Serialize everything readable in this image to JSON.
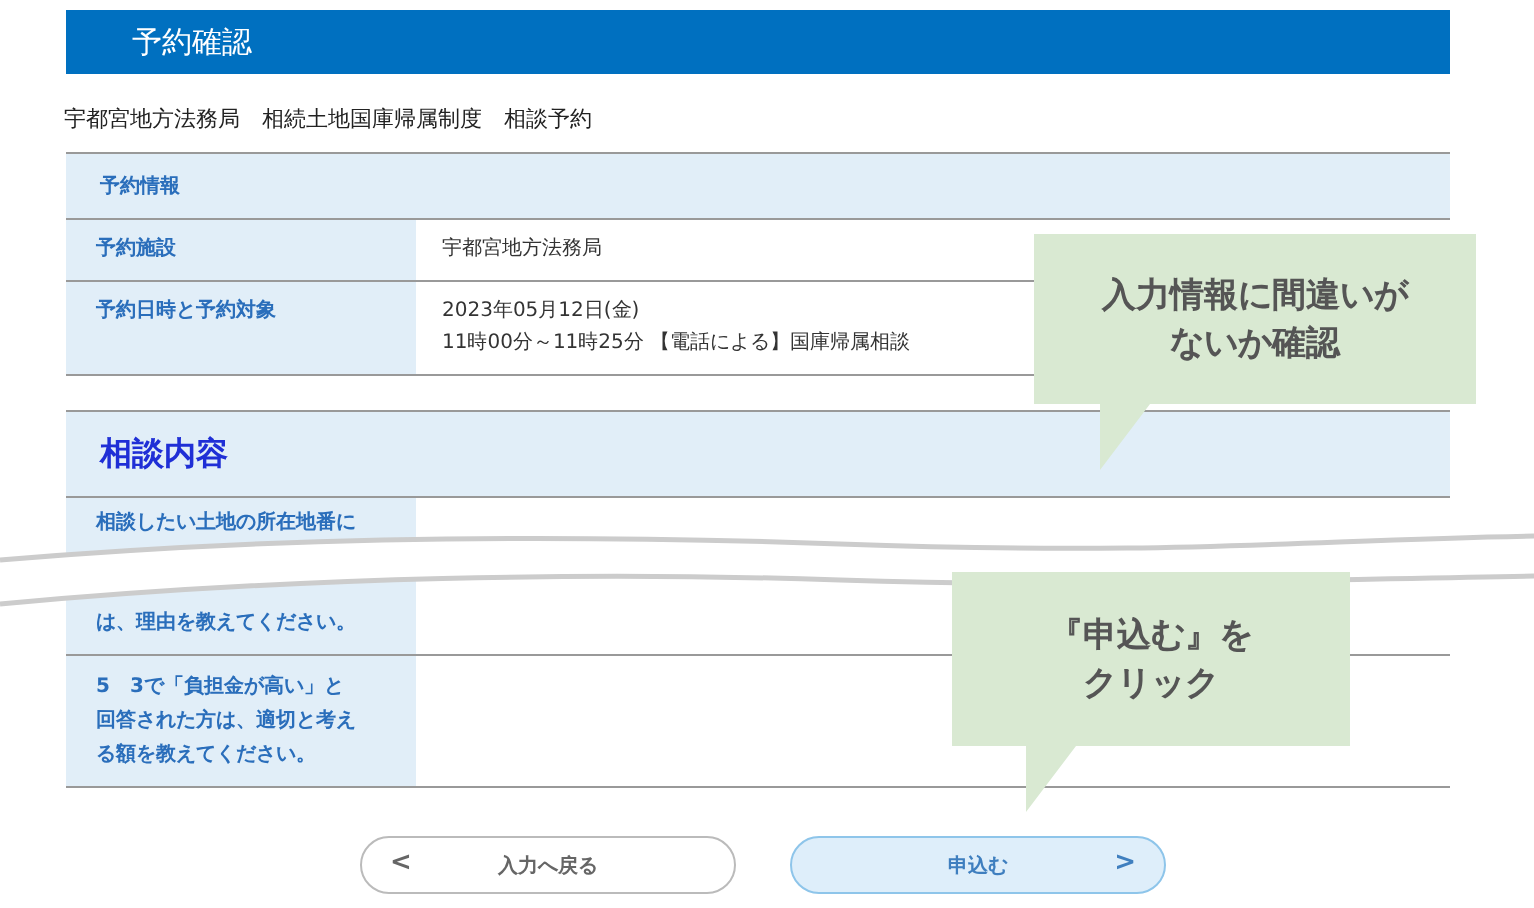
{
  "header": {
    "title": "予約確認"
  },
  "breadcrumb": "宇都宮地方法務局　相続土地国庫帰属制度　相談予約",
  "reservation_table": {
    "heading": "予約情報",
    "rows": [
      {
        "label": "予約施設",
        "value_lines": [
          "宇都宮地方法務局"
        ]
      },
      {
        "label": "予約日時と予約対象",
        "value_lines": [
          "2023年05月12日(金)",
          "11時00分～11時25分 【電話による】国庫帰属相談"
        ]
      }
    ]
  },
  "consultation_table": {
    "heading": "相談内容",
    "rows": [
      {
        "kind": "torn",
        "label_lines": [
          "相談したい土地の所在地番に",
          "は、理由を教えてください。"
        ]
      },
      {
        "kind": "plain",
        "label_lines": [
          "5　3で「負担金が高い」と",
          "回答された方は、適切と考え",
          "る額を教えてください。"
        ]
      }
    ]
  },
  "buttons": [
    {
      "kind": "back",
      "label": "入力へ戻る",
      "arrow": "<"
    },
    {
      "kind": "submit",
      "label": "申込む",
      "arrow": ">"
    }
  ],
  "callouts": [
    {
      "lines": [
        "入力情報に間違いが",
        "ないか確認"
      ]
    },
    {
      "lines": [
        "『申込む』を",
        "クリック"
      ]
    }
  ]
}
